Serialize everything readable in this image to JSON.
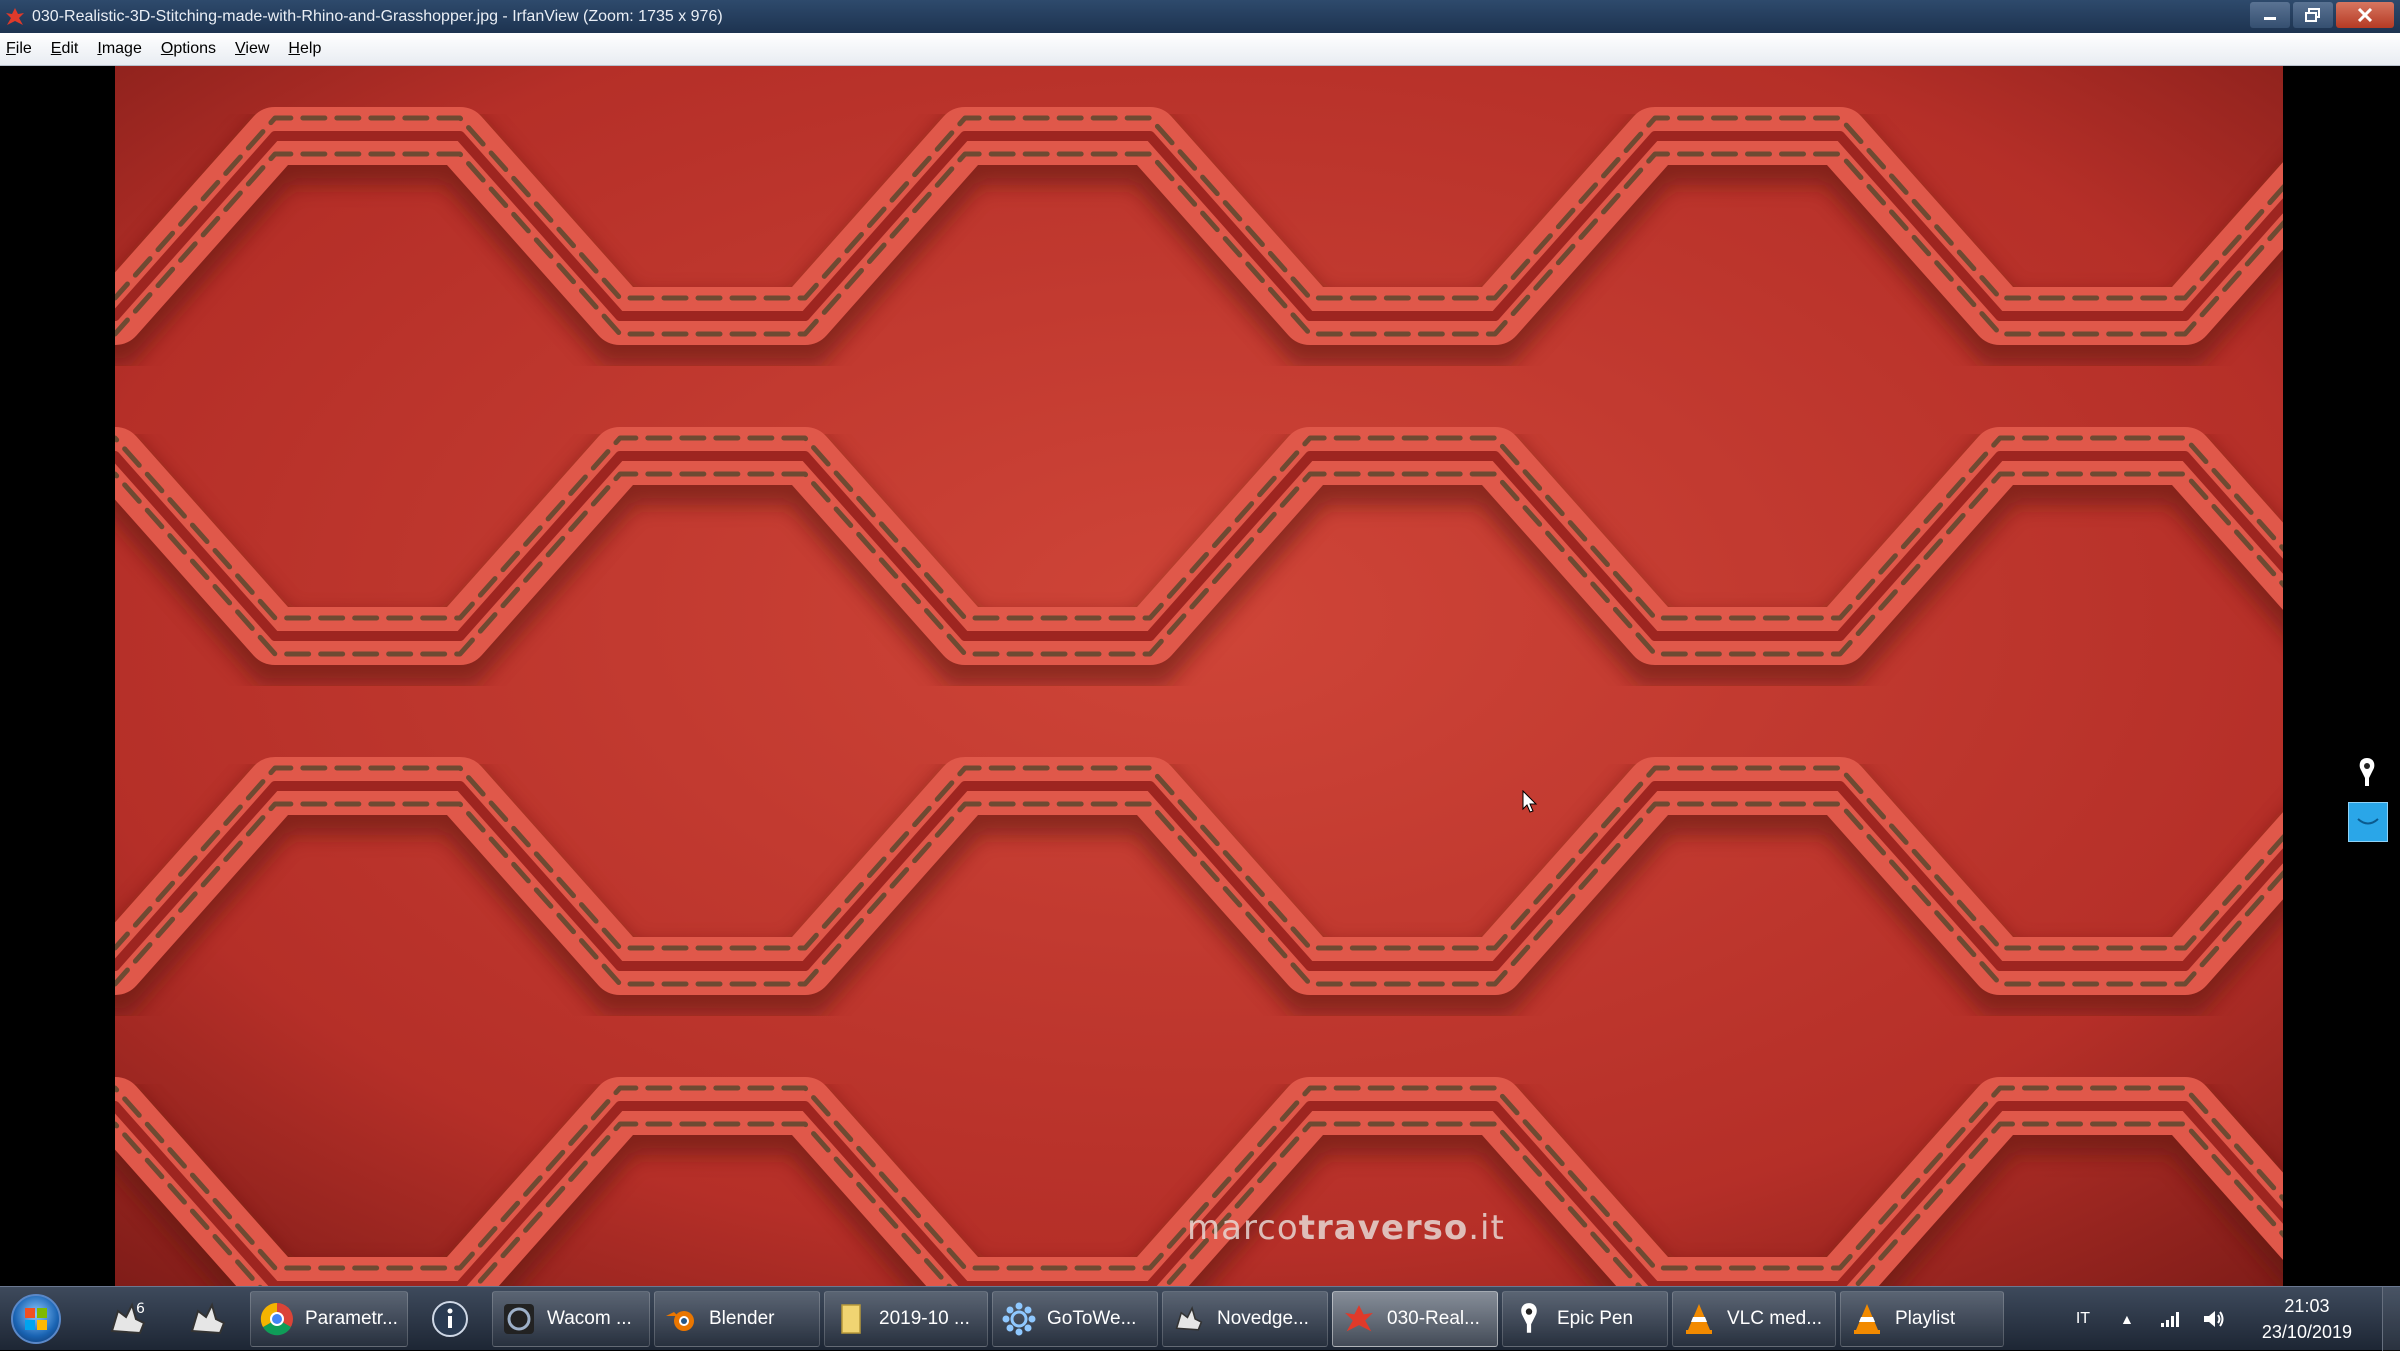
{
  "window": {
    "title": "030-Realistic-3D-Stitching-made-with-Rhino-and-Grasshopper.jpg - IrfanView (Zoom: 1735 x 976)",
    "minimize_icon": "minimize-icon",
    "maximize_icon": "restore-icon",
    "close_icon": "close-icon"
  },
  "menu": {
    "items": [
      {
        "label": "File"
      },
      {
        "label": "Edit"
      },
      {
        "label": "Image"
      },
      {
        "label": "Options"
      },
      {
        "label": "View"
      },
      {
        "label": "Help"
      }
    ]
  },
  "image": {
    "watermark_light": "marco",
    "watermark_bold": "traverso",
    "watermark_suffix": ".it",
    "leather_color": "#c0352d",
    "stitch_color": "#6e4a32"
  },
  "taskbar": {
    "items": [
      {
        "label": "",
        "icon": "rhino-icon"
      },
      {
        "label": "",
        "icon": "rhino-icon"
      },
      {
        "label": "Parametr...",
        "icon": "chrome-icon"
      },
      {
        "label": "",
        "icon": "info-icon"
      },
      {
        "label": "Wacom ...",
        "icon": "wacom-icon"
      },
      {
        "label": "Blender",
        "icon": "blender-icon"
      },
      {
        "label": "2019-10 ...",
        "icon": "folder-icon"
      },
      {
        "label": "GoToWe...",
        "icon": "gotowebinar-icon"
      },
      {
        "label": "Novedge...",
        "icon": "rhino-icon"
      },
      {
        "label": "030-Real...",
        "icon": "irfanview-icon"
      },
      {
        "label": "Epic Pen",
        "icon": "epic-pen-icon"
      },
      {
        "label": "VLC med...",
        "icon": "vlc-icon"
      },
      {
        "label": "Playlist",
        "icon": "vlc-icon"
      }
    ],
    "tray": {
      "language": "IT",
      "show_hidden": "▲",
      "time": "21:03",
      "date": "23/10/2019"
    }
  }
}
